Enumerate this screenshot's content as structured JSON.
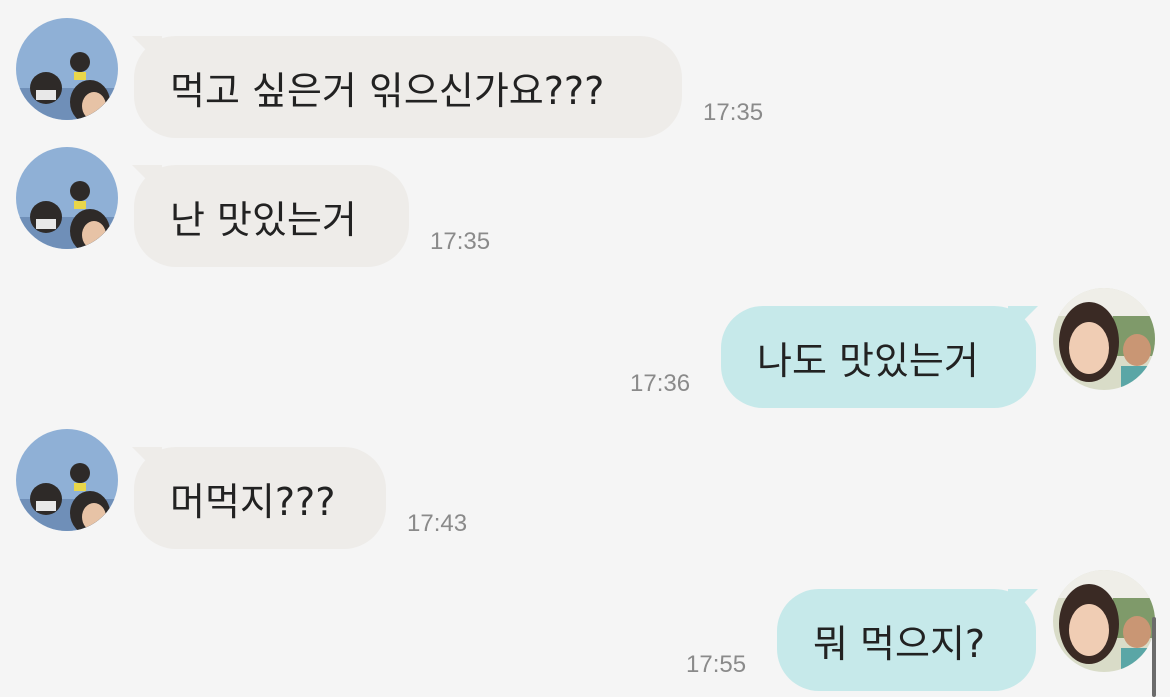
{
  "app": {
    "colors": {
      "background": "#f5f5f5",
      "incoming_bubble": "#eeece9",
      "outgoing_bubble": "#c6e9ea",
      "timestamp": "#8a8a8a"
    }
  },
  "messages": [
    {
      "direction": "incoming",
      "text": "먹고 싶은거 읶으신가요???",
      "time": "17:35",
      "avatar": "sender-avatar"
    },
    {
      "direction": "incoming",
      "text": "난 맛있는거",
      "time": "17:35",
      "avatar": "sender-avatar"
    },
    {
      "direction": "outgoing",
      "text": "나도 맛있는거",
      "time": "17:36",
      "avatar": "self-avatar"
    },
    {
      "direction": "incoming",
      "text": "머먹지???",
      "time": "17:43",
      "avatar": "sender-avatar"
    },
    {
      "direction": "outgoing",
      "text": "뭐 먹으지?",
      "time": "17:55",
      "avatar": "self-avatar"
    }
  ]
}
